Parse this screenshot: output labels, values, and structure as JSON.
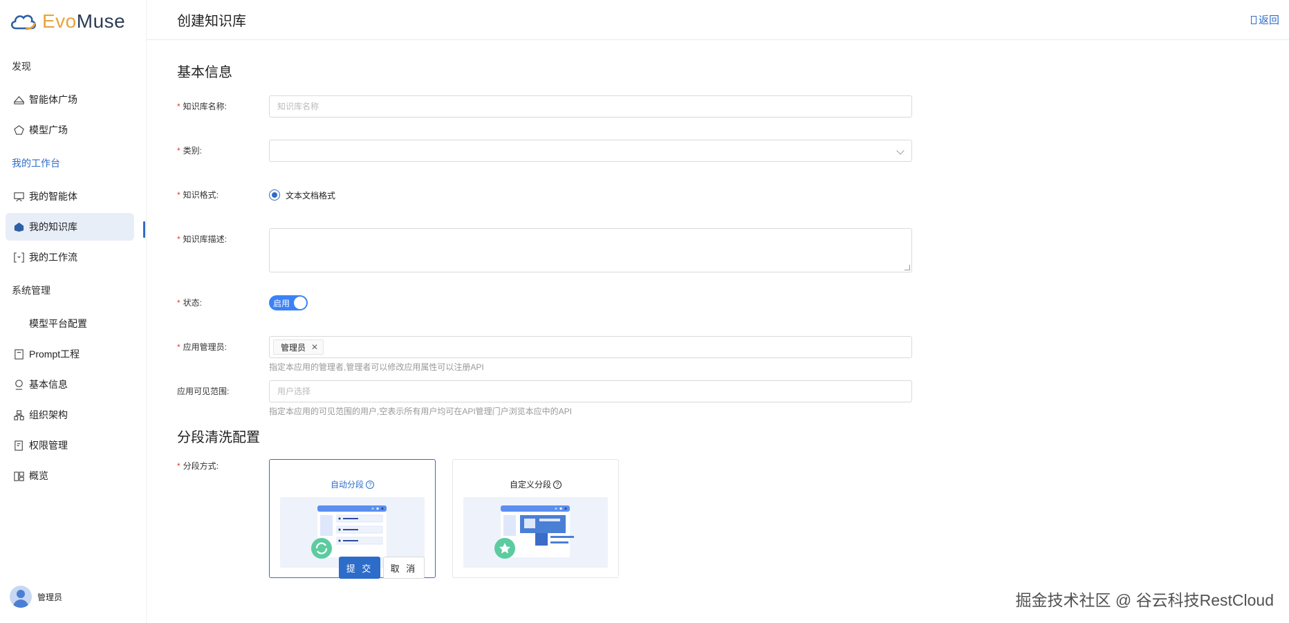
{
  "brand": {
    "evo": "Evo",
    "muse": "Muse"
  },
  "sidebar": {
    "sections": [
      {
        "label": "发现",
        "items": [
          {
            "label": "智能体广场",
            "icon": "agent-square-icon"
          },
          {
            "label": "模型广场",
            "icon": "model-square-icon"
          }
        ]
      },
      {
        "label": "我的工作台",
        "items": [
          {
            "label": "我的智能体",
            "icon": "my-agent-icon"
          },
          {
            "label": "我的知识库",
            "icon": "knowledge-base-icon",
            "active": true
          },
          {
            "label": "我的工作流",
            "icon": "workflow-icon"
          }
        ]
      },
      {
        "label": "系统管理",
        "items": [
          {
            "label": "模型平台配置",
            "icon": ""
          },
          {
            "label": "Prompt工程",
            "icon": "prompt-icon"
          },
          {
            "label": "基本信息",
            "icon": "basic-info-icon"
          },
          {
            "label": "组织架构",
            "icon": "org-structure-icon"
          },
          {
            "label": "权限管理",
            "icon": "permission-icon"
          },
          {
            "label": "概览",
            "icon": "overview-icon"
          }
        ]
      }
    ],
    "user": {
      "name": "管理员"
    }
  },
  "header": {
    "title": "创建知识库",
    "back": "返回"
  },
  "form": {
    "basic_title": "基本信息",
    "name": {
      "label": "知识库名称:",
      "placeholder": "知识库名称"
    },
    "category": {
      "label": "类别:",
      "value": ""
    },
    "format": {
      "label": "知识格式:",
      "option": "文本文档格式"
    },
    "description": {
      "label": "知识库描述:",
      "value": ""
    },
    "status": {
      "label": "状态:",
      "switch_text": "启用"
    },
    "admin": {
      "label": "应用管理员:",
      "tag": "管理员",
      "help": "指定本应用的管理者,管理者可以修改应用属性可以注册API"
    },
    "visibility": {
      "label": "应用可见范围:",
      "placeholder": "用户选择",
      "help": "指定本应用的可见范围的用户,空表示所有用户均可在API管理门户浏览本应中的API"
    },
    "segment_title": "分段清洗配置",
    "segment": {
      "label": "分段方式:",
      "auto": "自动分段",
      "custom": "自定义分段"
    },
    "submit": "提 交",
    "cancel": "取 消"
  },
  "colors": {
    "primary": "#2d6cc9",
    "required": "#e53935",
    "switch": "#3b82f6",
    "green": "#5ccba0"
  },
  "watermark": "掘金技术社区 @ 谷云科技RestCloud"
}
